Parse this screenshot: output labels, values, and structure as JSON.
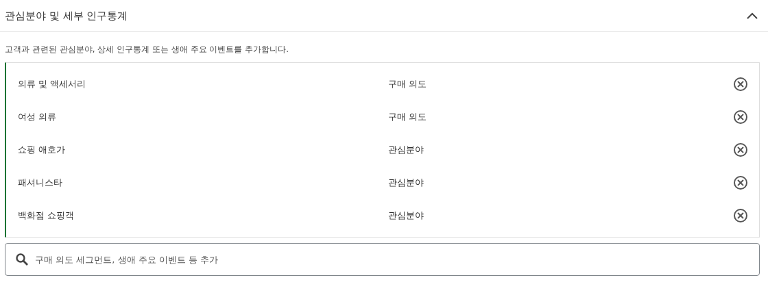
{
  "section": {
    "title": "관심분야 및 세부 인구통계",
    "expanded": true
  },
  "description": "고객과 관련된 관심분야, 상세 인구통계 또는 생애 주요 이벤트를 추가합니다.",
  "items": [
    {
      "name": "의류 및 액세서리",
      "type": "구매 의도"
    },
    {
      "name": "여성 의류",
      "type": "구매 의도"
    },
    {
      "name": "쇼핑 애호가",
      "type": "관심분야"
    },
    {
      "name": "패셔니스타",
      "type": "관심분야"
    },
    {
      "name": "백화점 쇼핑객",
      "type": "관심분야"
    }
  ],
  "search": {
    "placeholder": "구매 의도 세그먼트, 생애 주요 이벤트 등 추가"
  }
}
